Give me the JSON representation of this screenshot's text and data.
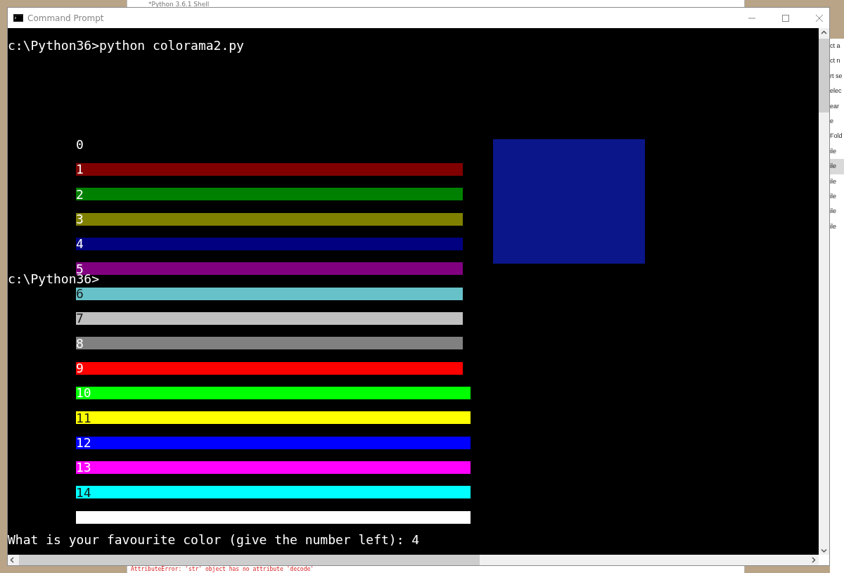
{
  "back_window": {
    "title": "*Python 3.6.1 Shell",
    "error_line": "AttributeError: 'str' object has no attribute 'decode'"
  },
  "side_panel": {
    "items": [
      {
        "text": "ct a",
        "selected": false
      },
      {
        "text": "ct n",
        "selected": false
      },
      {
        "text": "rt se",
        "selected": false
      },
      {
        "text": "elec",
        "selected": false
      },
      {
        "text": "ear",
        "selected": false
      },
      {
        "text": "e",
        "selected": false
      },
      {
        "text": "Fold",
        "selected": false
      },
      {
        "text": "ile",
        "selected": false
      },
      {
        "text": "ile",
        "selected": true
      },
      {
        "text": "ile",
        "selected": false
      },
      {
        "text": "ile",
        "selected": false
      },
      {
        "text": "ile",
        "selected": false
      },
      {
        "text": "ile",
        "selected": false
      }
    ]
  },
  "window": {
    "title": "Command Prompt"
  },
  "console": {
    "command_line": "c:\\Python36>python colorama2.py",
    "overlay_prompt": "c:\\Python36>",
    "rows": [
      {
        "label": "0",
        "kind": "none"
      },
      {
        "label": "1",
        "color": "#800000",
        "kind": "short"
      },
      {
        "label": "2",
        "color": "#008000",
        "kind": "short"
      },
      {
        "label": "3",
        "color": "#808000",
        "kind": "short"
      },
      {
        "label": "4",
        "color": "#000080",
        "kind": "short"
      },
      {
        "label": "5",
        "color": "#800080",
        "kind": "short"
      },
      {
        "label": "6",
        "color": "#66c2c8",
        "kind": "short"
      },
      {
        "label": "7",
        "color": "#c0c0c0",
        "kind": "short"
      },
      {
        "label": "8",
        "color": "#808080",
        "kind": "short"
      },
      {
        "label": "9",
        "color": "#ff0000",
        "kind": "short"
      },
      {
        "label": "10",
        "color": "#00ff00",
        "kind": "long"
      },
      {
        "label": "11",
        "color": "#ffff00",
        "kind": "long"
      },
      {
        "label": "12",
        "color": "#0000ff",
        "kind": "long"
      },
      {
        "label": "13",
        "color": "#ff00ff",
        "kind": "long"
      },
      {
        "label": "14",
        "color": "#00ffff",
        "kind": "long"
      },
      {
        "color": "#ffffff",
        "kind": "long"
      }
    ],
    "question": "What is your favourite color (give the number left): 4"
  }
}
